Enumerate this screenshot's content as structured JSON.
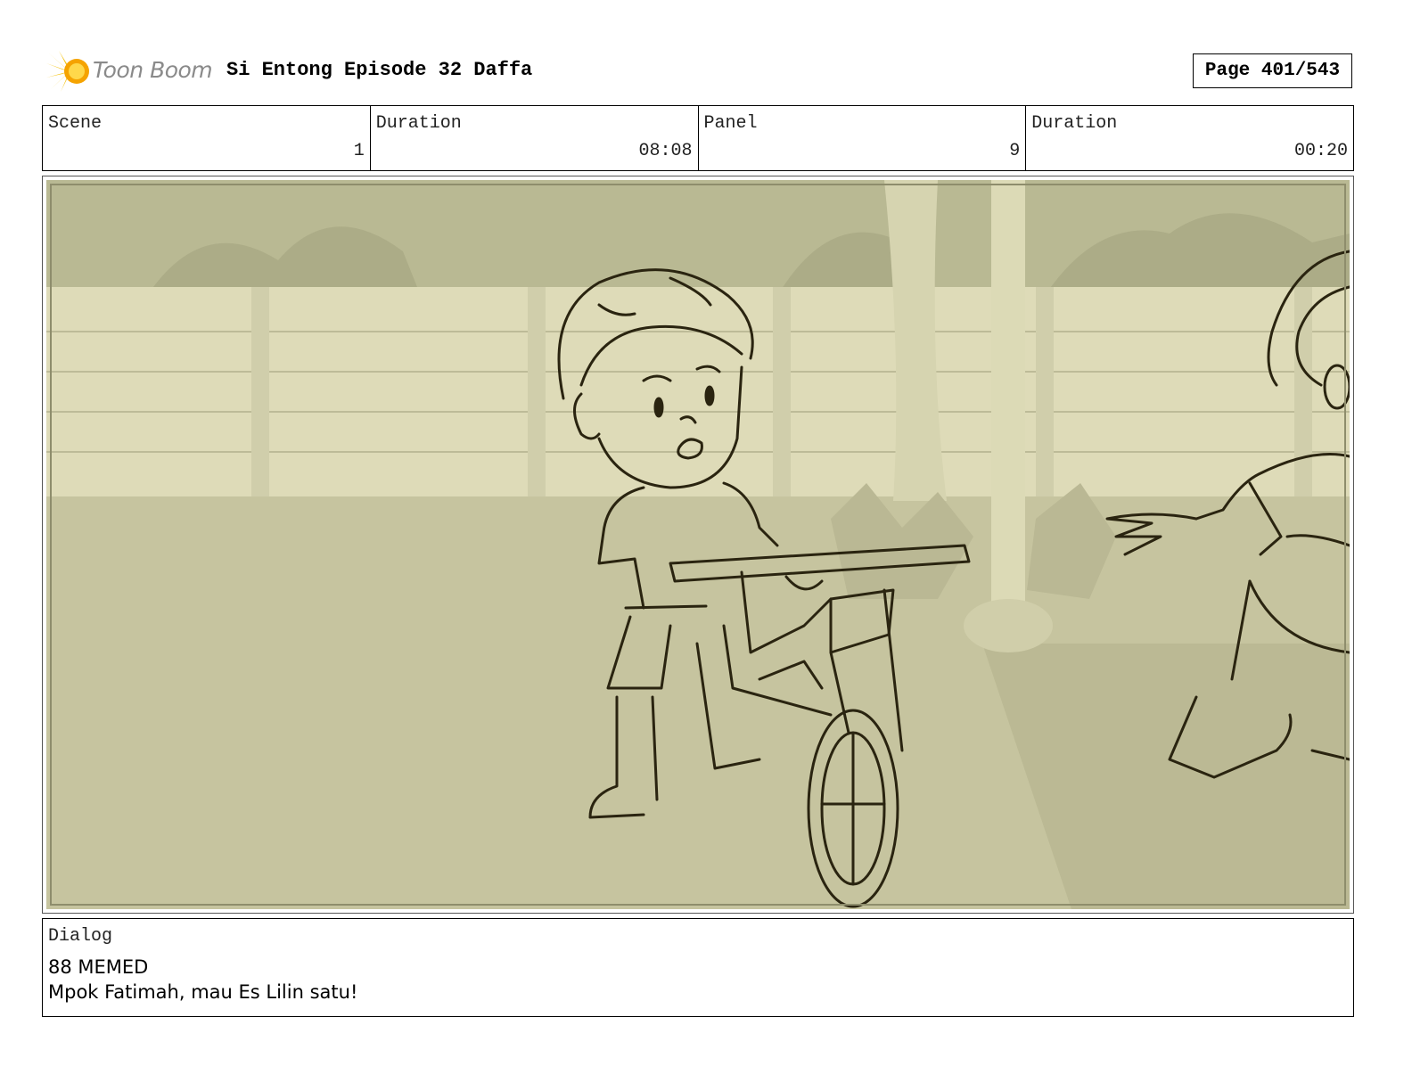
{
  "header": {
    "logo_text": "Toon Boom",
    "title": "Si Entong Episode 32 Daffa",
    "page": "Page 401/543"
  },
  "info": {
    "scene_label": "Scene",
    "scene_value": "1",
    "scene_duration_label": "Duration",
    "scene_duration_value": "08:08",
    "panel_label": "Panel",
    "panel_value": "9",
    "panel_duration_label": "Duration",
    "panel_duration_value": "00:20"
  },
  "dialog": {
    "label": "Dialog",
    "line1": "88 MEMED",
    "line2": "Mpok Fatimah, mau Es Lilin satu!"
  },
  "colors": {
    "panel_bg": "#c9c9a3",
    "sketch_line": "#2a2410",
    "logo_accent": "#f5c518"
  },
  "icons": {
    "logo": "toon-boom-sun-icon"
  }
}
